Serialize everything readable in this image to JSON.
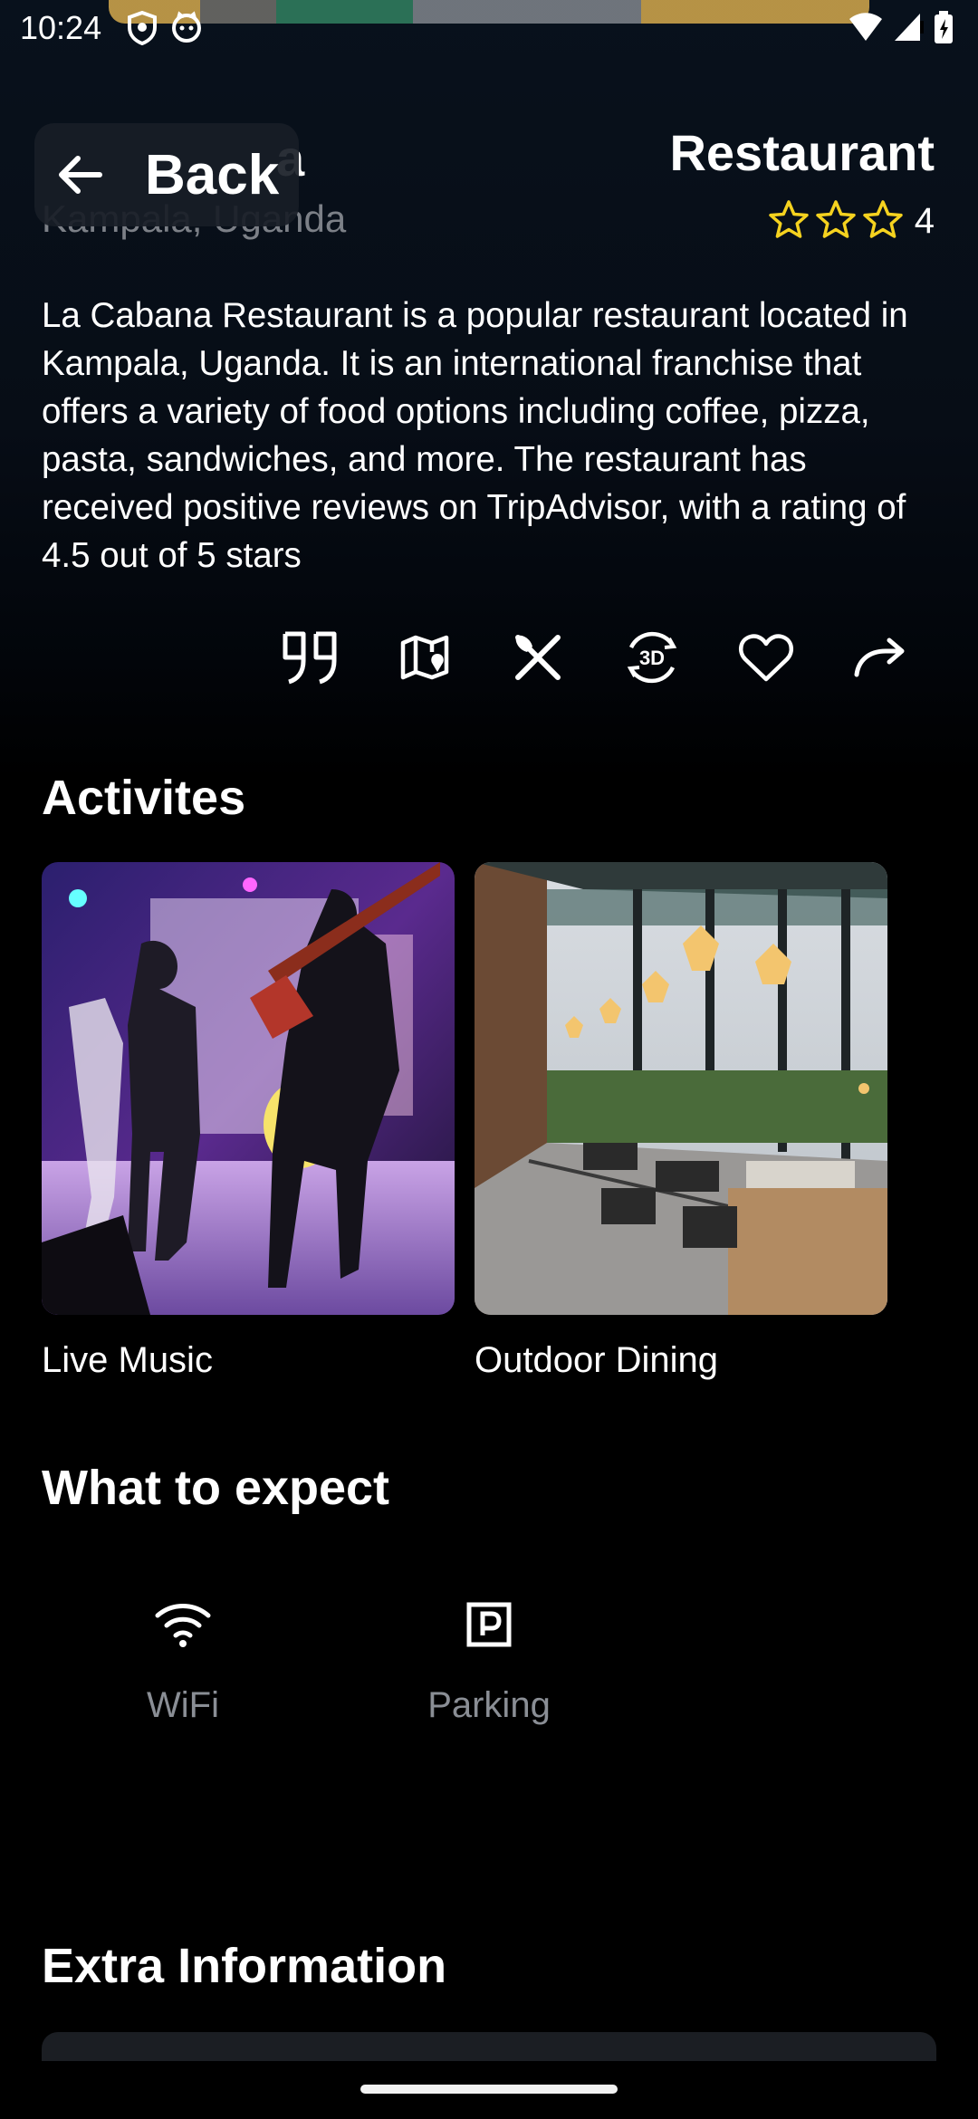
{
  "status_bar": {
    "time": "10:24",
    "icons": [
      "shield-icon",
      "cat-icon",
      "wifi-icon",
      "signal-icon",
      "battery-icon"
    ]
  },
  "header": {
    "title_partial": "a",
    "subtitle": "Kampala, Uganda",
    "back_label": "Back",
    "category": "Restaurant",
    "rating_value": "4",
    "star_color": "#F5D21F"
  },
  "description": "La Cabana Restaurant is a popular restaurant located in Kampala, Uganda. It is an international franchise that offers a variety of food options including coffee, pizza, pasta, sandwiches, and more. The restaurant has received positive reviews on TripAdvisor, with a rating of 4.5 out of 5 stars",
  "actions": [
    "quote-icon",
    "map-icon",
    "dining-icon",
    "3d-view-icon",
    "favorite-icon",
    "share-icon"
  ],
  "activities": {
    "title": "Activites",
    "items": [
      {
        "label": "Live Music"
      },
      {
        "label": "Outdoor Dining"
      }
    ]
  },
  "expect": {
    "title": "What to expect",
    "items": [
      {
        "label": "WiFi",
        "icon": "wifi-icon"
      },
      {
        "label": "Parking",
        "icon": "parking-icon"
      }
    ]
  },
  "extra": {
    "title": "Extra Information"
  }
}
